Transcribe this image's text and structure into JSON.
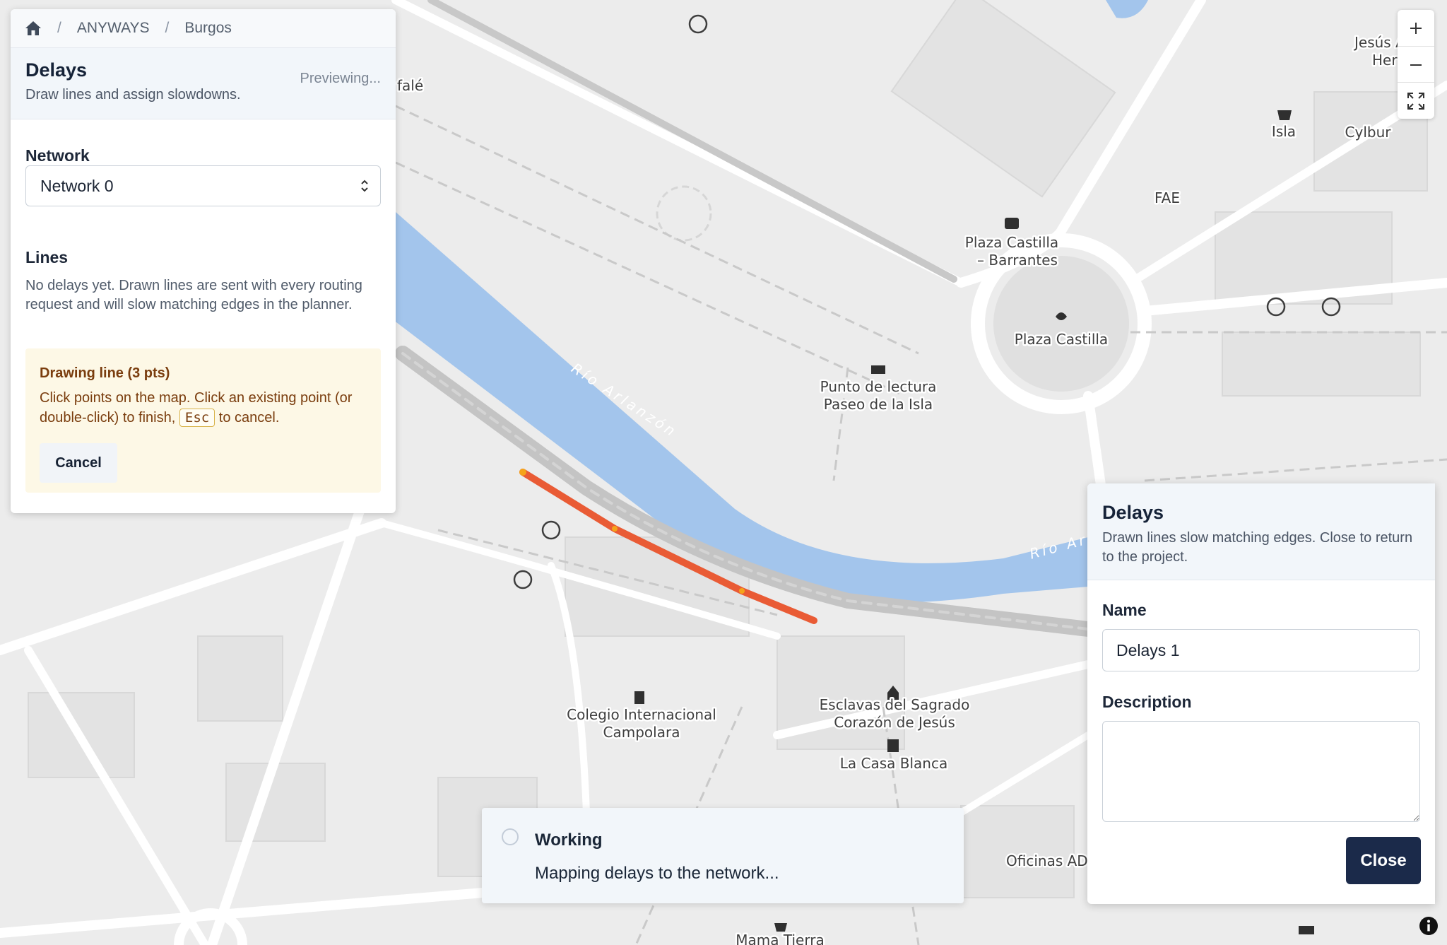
{
  "breadcrumb": {
    "home_icon": "home-icon",
    "items": [
      "ANYWAYS",
      "Burgos"
    ]
  },
  "panel": {
    "title": "Delays",
    "subtitle": "Draw lines and assign slowdowns.",
    "status": "Previewing...",
    "network_label": "Network",
    "network_value": "Network 0",
    "lines_label": "Lines",
    "lines_empty_text": "No delays yet. Drawn lines are sent with every routing request and will slow matching edges in the planner.",
    "drawing": {
      "title": "Drawing line (3 pts)",
      "instruction_before": "Click points on the map. Click an existing point (or double-click) to finish,",
      "key": "Esc",
      "instruction_after": "to cancel.",
      "cancel_label": "Cancel"
    }
  },
  "dialog": {
    "title": "Delays",
    "subtitle": "Drawn lines slow matching edges. Close to return to the project.",
    "name_label": "Name",
    "name_value": "Delays 1",
    "description_label": "Description",
    "description_value": "",
    "close_label": "Close"
  },
  "toast": {
    "title": "Working",
    "message": "Mapping delays to the network..."
  },
  "map": {
    "labels": {
      "river_1": "Río Arlanzón",
      "river_2": "Río Ar",
      "plaza_castilla_barrantes_1": "Plaza Castilla",
      "plaza_castilla_barrantes_2": "– Barrantes",
      "plaza_castilla": "Plaza Castilla",
      "punto_lectura_1": "Punto de lectura",
      "punto_lectura_2": "Paseo de la Isla",
      "colegio_1": "Colegio Internacional",
      "colegio_2": "Campolara",
      "esclavas_1": "Esclavas del Sagrado",
      "esclavas_2": "Corazón de Jesús",
      "casa_blanca": "La Casa Blanca",
      "oficinas": "Oficinas ADI",
      "isla": "Isla",
      "cylbur": "Cylbur",
      "fae": "FAE",
      "jesus_1": "Jesús A",
      "jesus_2": "Her",
      "mama_tierra": "Mama Tierra",
      "fale": "falé"
    },
    "colors": {
      "water": "#a3c5ec",
      "road": "#ffffff",
      "rail": "#c4c4c4",
      "delay_line": "#e95b35",
      "block": "#e2e2e2"
    }
  },
  "controls": {
    "zoom_in_icon": "plus-icon",
    "zoom_out_icon": "minus-icon",
    "fullscreen_icon": "fullscreen-icon",
    "info_icon": "info-icon"
  }
}
